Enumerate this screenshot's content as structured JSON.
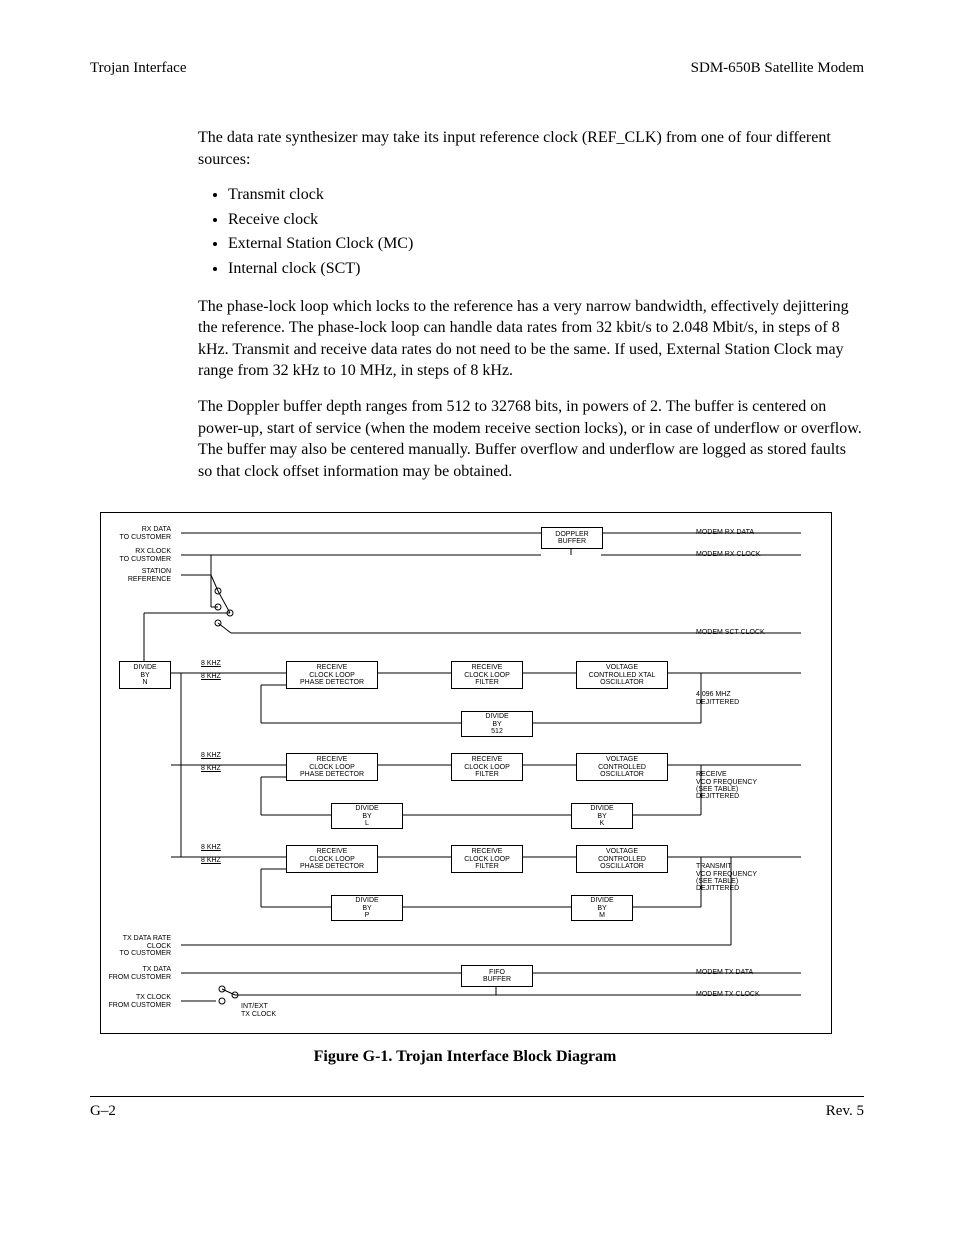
{
  "header": {
    "left": "Trojan Interface",
    "right": "SDM-650B Satellite Modem"
  },
  "body": {
    "p1": "The data rate synthesizer may take its input reference clock (REF_CLK) from one of four different sources:",
    "bullets": [
      "Transmit clock",
      "Receive clock",
      "External Station Clock (MC)",
      "Internal clock (SCT)"
    ],
    "p2": "The phase-lock loop which locks to the reference has a very narrow bandwidth, effectively dejittering the reference. The phase-lock loop can handle data rates from 32 kbit/s to 2.048 Mbit/s, in steps of 8 kHz. Transmit and receive data rates do not need to be the same. If used, External Station Clock may range from 32 kHz to 10 MHz, in steps of 8 kHz.",
    "p3": "The Doppler buffer depth ranges from 512 to 32768 bits, in powers of 2. The buffer is centered on power-up, start of service (when the modem receive section locks), or in case of underflow or overflow. The buffer may also be centered manually. Buffer overflow and underflow are logged as stored faults so that clock offset information may be obtained."
  },
  "figure": {
    "caption": "Figure G-1.  Trojan Interface Block Diagram",
    "labels": {
      "rx_data_to_cust": "RX DATA\nTO CUSTOMER",
      "rx_clock_to_cust": "RX CLOCK\nTO CUSTOMER",
      "station_ref": "STATION\nREFERENCE",
      "doppler_buffer": "DOPPLER\nBUFFER",
      "modem_rx_data": "MODEM RX DATA",
      "modem_rx_clock": "MODEM RX CLOCK",
      "modem_sct_clock": "MODEM SCT CLOCK",
      "divide_by_n": "DIVIDE\nBY\nN",
      "khz8_1a": "8 KHZ",
      "khz8_1b": "8 KHZ",
      "rcv_clk_loop_pd": "RECEIVE\nCLOCK LOOP\nPHASE DETECTOR",
      "rcv_clk_loop_filter": "RECEIVE\nCLOCK LOOP\nFILTER",
      "vcxo": "VOLTAGE\nCONTROLLED XTAL\nOSCILLATOR",
      "mhz4096": "4.096 MHZ\nDEJITTERED",
      "divide_by_512": "DIVIDE\nBY\n512",
      "khz8_2a": "8 KHZ",
      "khz8_2b": "8 KHZ",
      "vco": "VOLTAGE\nCONTROLLED\nOSCILLATOR",
      "rx_vco_freq": "RECEIVE\nVCO FREQUENCY\n(SEE TABLE)\nDEJITTERED",
      "divide_by_l": "DIVIDE\nBY\nL",
      "divide_by_k": "DIVIDE\nBY\nK",
      "khz8_3a": "8 KHZ",
      "khz8_3b": "8 KHZ",
      "tx_vco_freq": "TRANSMIT\nVCO FREQUENCY\n(SEE TABLE)\nDEJITTERED",
      "divide_by_p": "DIVIDE\nBY\nP",
      "divide_by_m": "DIVIDE\nBY\nM",
      "tx_data_rate_clk": "TX DATA RATE\nCLOCK\nTO CUSTOMER",
      "tx_data_from_cust": "TX DATA\nFROM CUSTOMER",
      "tx_clock_from_cust": "TX CLOCK\nFROM CUSTOMER",
      "fifo_buffer": "FIFO\nBUFFER",
      "modem_tx_data": "MODEM TX DATA",
      "modem_tx_clock": "MODEM TX CLOCK",
      "int_ext_tx_clock": "INT/EXT\nTX CLOCK"
    }
  },
  "footer": {
    "left": "G–2",
    "right": "Rev. 5"
  }
}
